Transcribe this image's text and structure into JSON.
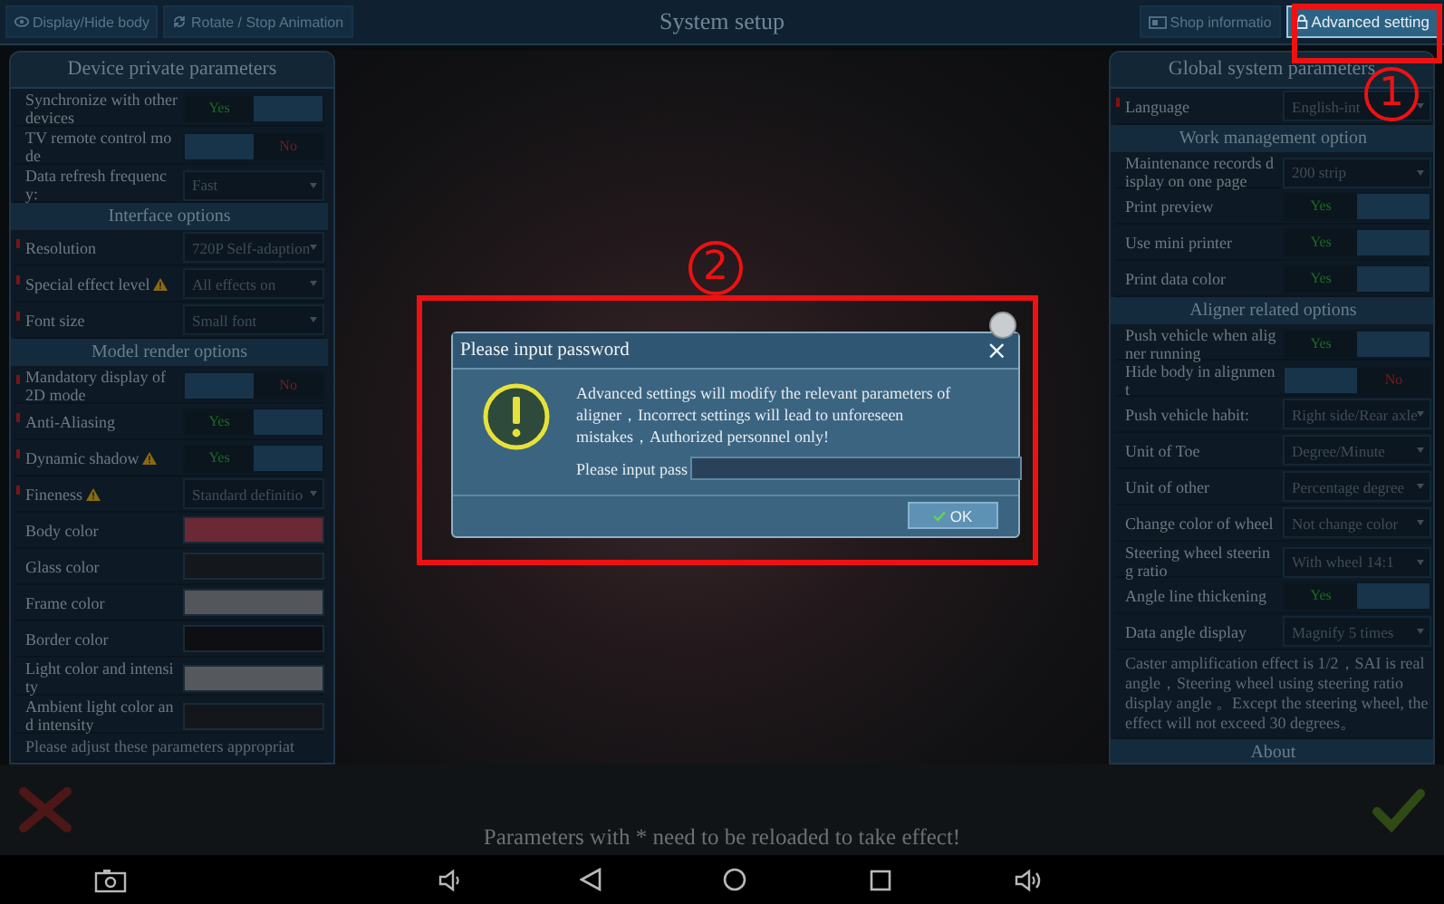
{
  "top_bar": {
    "title": "System setup",
    "buttons": [
      {
        "label": "Display/Hide body",
        "selected": false
      },
      {
        "label": "Rotate / Stop Animation",
        "selected": false
      },
      {
        "label": "Shop informatio",
        "selected": false
      },
      {
        "label": "Advanced setting",
        "selected": true
      }
    ]
  },
  "left_panel": {
    "title": "Device private parameters",
    "groups": [
      {
        "rows": [
          {
            "kind": "toggle",
            "label": "Synchronize with other devices",
            "reload": false,
            "warning": false,
            "on": true,
            "value": "Yes"
          },
          {
            "kind": "toggle",
            "label": "TV remote control mode",
            "reload": false,
            "warning": false,
            "on": false,
            "value": "No"
          },
          {
            "kind": "select",
            "label": "Data refresh frequency:",
            "reload": false,
            "warning": false,
            "value": "Fast"
          }
        ]
      },
      {
        "heading": "Interface options",
        "rows": [
          {
            "kind": "select",
            "label": "Resolution",
            "reload": true,
            "warning": false,
            "value": "720P Self-adaption"
          },
          {
            "kind": "select",
            "label": "Special effect level",
            "reload": true,
            "warning": true,
            "value": "All effects on"
          },
          {
            "kind": "select",
            "label": "Font size",
            "reload": true,
            "warning": false,
            "value": "Small font"
          }
        ]
      },
      {
        "heading": "Model render options",
        "rows": [
          {
            "kind": "toggle",
            "label": "Mandatory display of 2D mode",
            "reload": true,
            "warning": false,
            "on": false,
            "value": "No"
          },
          {
            "kind": "toggle",
            "label": "Anti-Aliasing",
            "reload": true,
            "warning": false,
            "on": true,
            "value": "Yes"
          },
          {
            "kind": "toggle",
            "label": "Dynamic shadow",
            "reload": true,
            "warning": true,
            "on": true,
            "value": "Yes"
          },
          {
            "kind": "select",
            "label": "Fineness",
            "reload": true,
            "warning": true,
            "value": "Standard definitio"
          },
          {
            "kind": "color",
            "label": "Body color",
            "reload": false,
            "warning": false,
            "color": "#6b2935"
          },
          {
            "kind": "color",
            "label": "Glass color",
            "reload": false,
            "warning": false,
            "color": "#14181d"
          },
          {
            "kind": "color",
            "label": "Frame color",
            "reload": false,
            "warning": false,
            "color": "#53575b"
          },
          {
            "kind": "color",
            "label": "Border color",
            "reload": false,
            "warning": false,
            "color": "#0d0f13"
          },
          {
            "kind": "color",
            "label": "Light color and intensity",
            "reload": false,
            "warning": false,
            "color": "#55595d"
          },
          {
            "kind": "color",
            "label": "Ambient light color and intensity",
            "reload": false,
            "warning": false,
            "color": "#13171b"
          },
          {
            "kind": "note",
            "text": "Please adjust these parameters appropriat"
          }
        ]
      }
    ]
  },
  "right_panel": {
    "title": "Global system parameters",
    "groups": [
      {
        "rows": [
          {
            "kind": "select",
            "label": "Language",
            "reload": true,
            "warning": false,
            "value": "English-int"
          }
        ]
      },
      {
        "heading": "Work management option",
        "rows": [
          {
            "kind": "select",
            "label": "Maintenance records display on one page",
            "reload": false,
            "warning": false,
            "value": "200 strip"
          },
          {
            "kind": "toggle",
            "label": "Print preview",
            "reload": false,
            "warning": false,
            "on": true,
            "value": "Yes"
          },
          {
            "kind": "toggle",
            "label": "Use mini printer",
            "reload": false,
            "warning": false,
            "on": true,
            "value": "Yes"
          },
          {
            "kind": "toggle",
            "label": "Print data color",
            "reload": false,
            "warning": false,
            "on": true,
            "value": "Yes"
          }
        ]
      },
      {
        "heading": "Aligner related options",
        "rows": [
          {
            "kind": "toggle",
            "label": "Push vehicle when aligner running",
            "reload": false,
            "warning": false,
            "on": true,
            "value": "Yes"
          },
          {
            "kind": "toggle",
            "label": "Hide body in alignment",
            "reload": false,
            "warning": false,
            "on": false,
            "value": "No"
          },
          {
            "kind": "select",
            "label": "Push vehicle habit:",
            "reload": false,
            "warning": false,
            "value": "Right side/Rear axle"
          },
          {
            "kind": "select",
            "label": "Unit of Toe",
            "reload": false,
            "warning": false,
            "value": "Degree/Minute"
          },
          {
            "kind": "select",
            "label": "Unit of other",
            "reload": false,
            "warning": false,
            "value": "Percentage degree"
          },
          {
            "kind": "select",
            "label": "Change color of wheel",
            "reload": false,
            "warning": false,
            "value": "Not change color"
          },
          {
            "kind": "select",
            "label": "Steering wheel steering ratio",
            "reload": false,
            "warning": false,
            "value": "With wheel 14:1"
          },
          {
            "kind": "toggle",
            "label": "Angle line thickening",
            "reload": false,
            "warning": false,
            "on": true,
            "value": "Yes"
          },
          {
            "kind": "select",
            "label": "Data angle display",
            "reload": false,
            "warning": false,
            "value": "Magnify 5 times"
          },
          {
            "kind": "note",
            "text": "Caster amplification effect is 1/2，SAI is real angle，Steering wheel using steering ratio display angle 。Except the steering wheel, the effect will not exceed 30 degrees。"
          }
        ]
      },
      {
        "heading": "About"
      }
    ]
  },
  "dialog": {
    "title": "Please input password",
    "close": "×",
    "message": "Advanced settings will modify the relevant parameters of aligner，Incorrect settings will lead to unforeseen mistakes，Authorized personnel only!",
    "field_label": "Please input pass",
    "ok": "OK"
  },
  "footer": {
    "message": "Parameters with * need to be reloaded to take effect!"
  },
  "annotations": [
    {
      "label": "1"
    },
    {
      "label": "2"
    }
  ]
}
